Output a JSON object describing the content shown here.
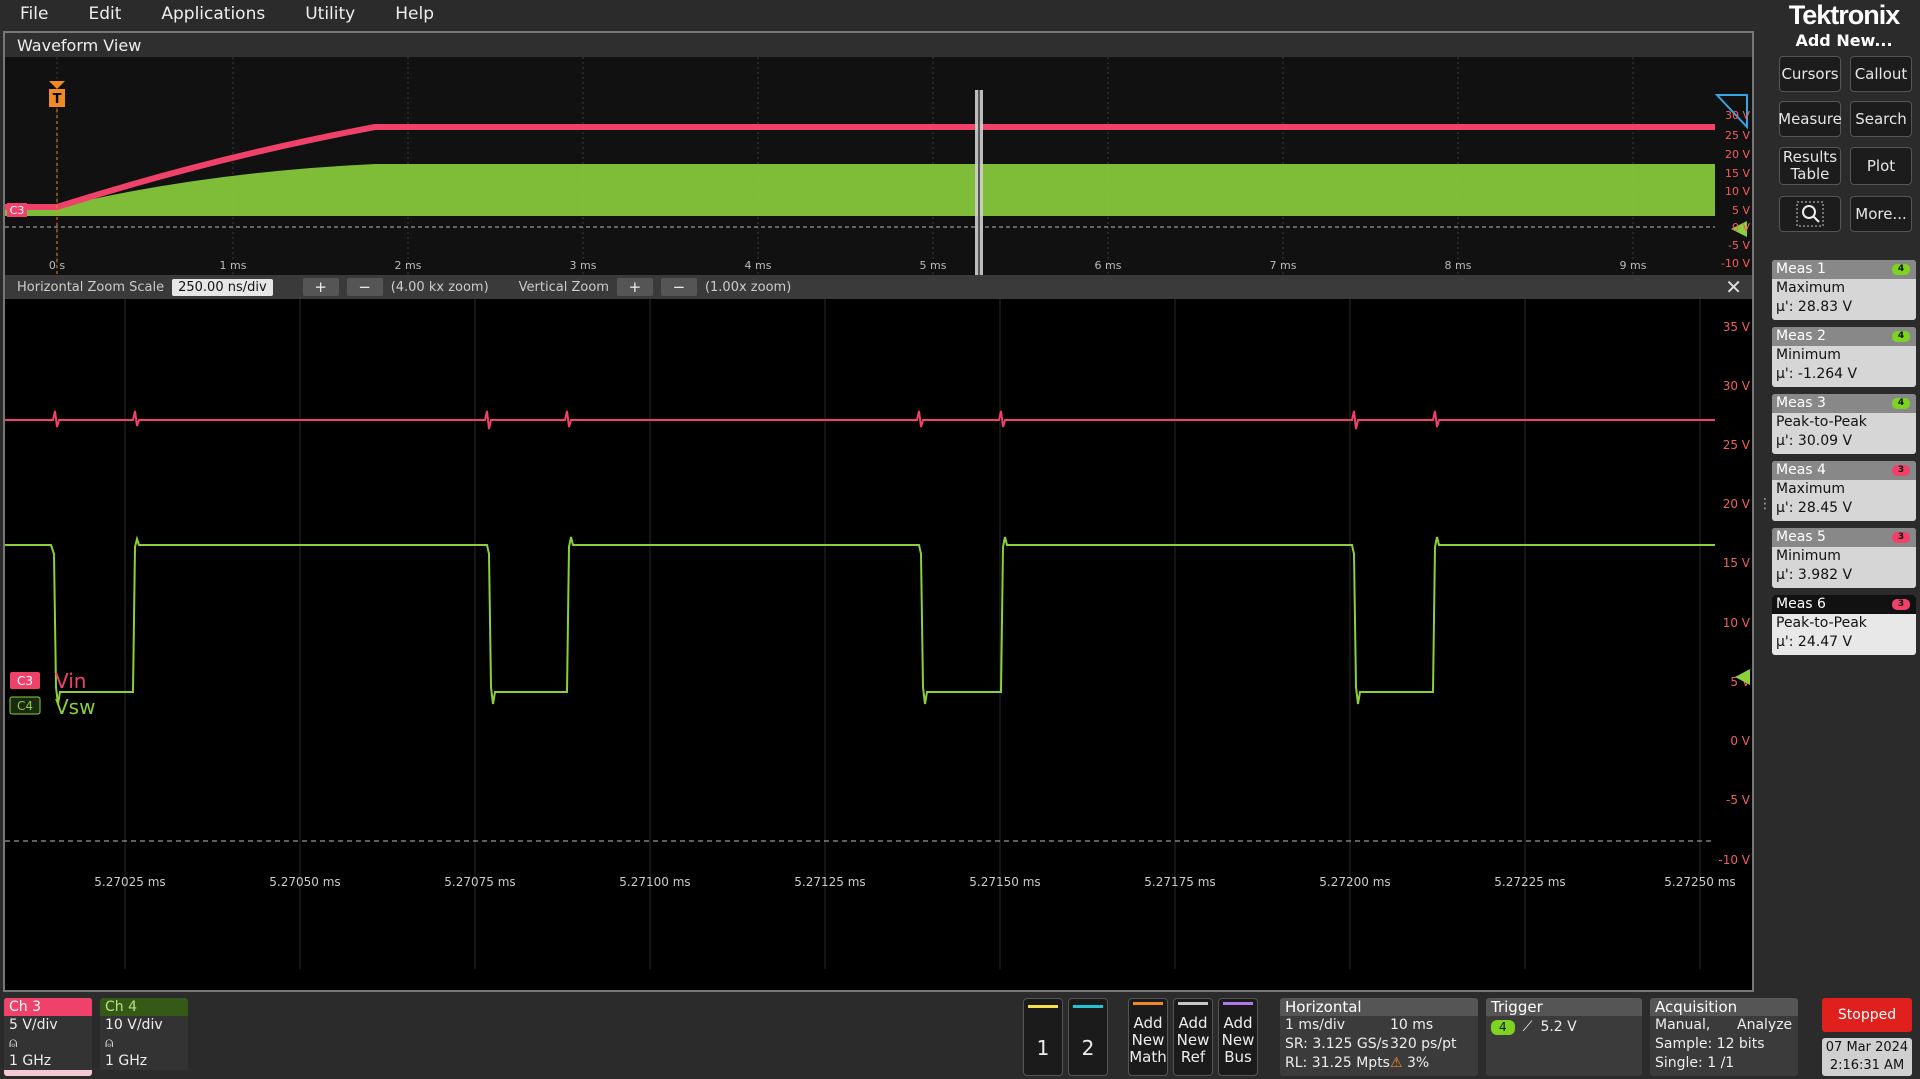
{
  "menu": [
    "File",
    "Edit",
    "Applications",
    "Utility",
    "Help"
  ],
  "brand": "Tektronix",
  "waveform_view": {
    "title": "Waveform View",
    "overview": {
      "trigger_marker": "T",
      "time_labels": [
        "0 s",
        "1 ms",
        "2 ms",
        "3 ms",
        "4 ms",
        "5 ms",
        "6 ms",
        "7 ms",
        "8 ms",
        "9 ms"
      ],
      "volt_labels": [
        "30 V",
        "25 V",
        "20 V",
        "15 V",
        "10 V",
        "5 V",
        "0 V",
        "-5 V",
        "-10 V"
      ],
      "channel_tag": "C3"
    },
    "zoom_bar": {
      "h_label": "Horizontal Zoom Scale",
      "h_value": "250.00 ns/div",
      "h_factor": "(4.00 kx zoom)",
      "v_label": "Vertical Zoom",
      "v_factor": "(1.00x zoom)",
      "plus": "+",
      "minus": "−",
      "close": "✕"
    },
    "main": {
      "volt_labels": [
        "35 V",
        "30 V",
        "25 V",
        "20 V",
        "15 V",
        "10 V",
        "5 V",
        "0 V",
        "-5 V",
        "-10 V"
      ],
      "time_labels": [
        "5.27025 ms",
        "5.27050 ms",
        "5.27075 ms",
        "5.27100 ms",
        "5.27125 ms",
        "5.27150 ms",
        "5.27175 ms",
        "5.27200 ms",
        "5.27225 ms",
        "5.27250 ms"
      ],
      "channel_tags": [
        {
          "tag": "C3",
          "name": "Vin",
          "color": "#f0416b"
        },
        {
          "tag": "C4",
          "name": "Vsw",
          "color": "#8ccf3c"
        }
      ]
    }
  },
  "right_panel": {
    "add_new": "Add New...",
    "buttons": [
      "Cursors",
      "Callout",
      "Measure",
      "Search",
      "Results Table",
      "Plot",
      "More..."
    ],
    "measurements": [
      {
        "name": "Meas 1",
        "type": "Maximum",
        "value": "µ': 28.83 V",
        "ch": "4",
        "badge_color": "#7ed321"
      },
      {
        "name": "Meas 2",
        "type": "Minimum",
        "value": "µ': -1.264 V",
        "ch": "4",
        "badge_color": "#7ed321"
      },
      {
        "name": "Meas 3",
        "type": "Peak-to-Peak",
        "value": "µ': 30.09 V",
        "ch": "4",
        "badge_color": "#7ed321"
      },
      {
        "name": "Meas 4",
        "type": "Maximum",
        "value": "µ': 28.45 V",
        "ch": "3",
        "badge_color": "#f0416b"
      },
      {
        "name": "Meas 5",
        "type": "Minimum",
        "value": "µ': 3.982 V",
        "ch": "3",
        "badge_color": "#f0416b"
      },
      {
        "name": "Meas 6",
        "type": "Peak-to-Peak",
        "value": "µ': 24.47 V",
        "ch": "3",
        "badge_color": "#f0416b"
      }
    ]
  },
  "bottom": {
    "ch3": {
      "title": "Ch 3",
      "scale": "5 V/div",
      "bw": "1 GHz",
      "color": "#f0416b"
    },
    "ch4": {
      "title": "Ch 4",
      "scale": "10 V/div",
      "bw": "1 GHz",
      "color": "#8ccf3c"
    },
    "slots": [
      {
        "num": "1",
        "color": "#f5e04a"
      },
      {
        "num": "2",
        "color": "#22c4d4"
      }
    ],
    "add_buttons": [
      {
        "label": "Add New Math",
        "color": "#f08a24"
      },
      {
        "label": "Add New Ref",
        "color": "#c8c8c8"
      },
      {
        "label": "Add New Bus",
        "color": "#b07ae8"
      }
    ],
    "horizontal": {
      "title": "Horizontal",
      "scale": "1 ms/div",
      "length": "10 ms",
      "sr": "SR: 3.125 GS/s",
      "res": "320 ps/pt",
      "rl": "RL: 31.25 Mpts",
      "pct": "3%"
    },
    "trigger": {
      "title": "Trigger",
      "ch": "4",
      "level": "5.2 V"
    },
    "acquisition": {
      "title": "Acquisition",
      "mode": "Manual,",
      "analyze": "Analyze",
      "sample": "Sample: 12 bits",
      "single": "Single: 1 /1"
    },
    "status": "Stopped",
    "date": "07 Mar 2024",
    "time": "2:16:31 AM"
  }
}
